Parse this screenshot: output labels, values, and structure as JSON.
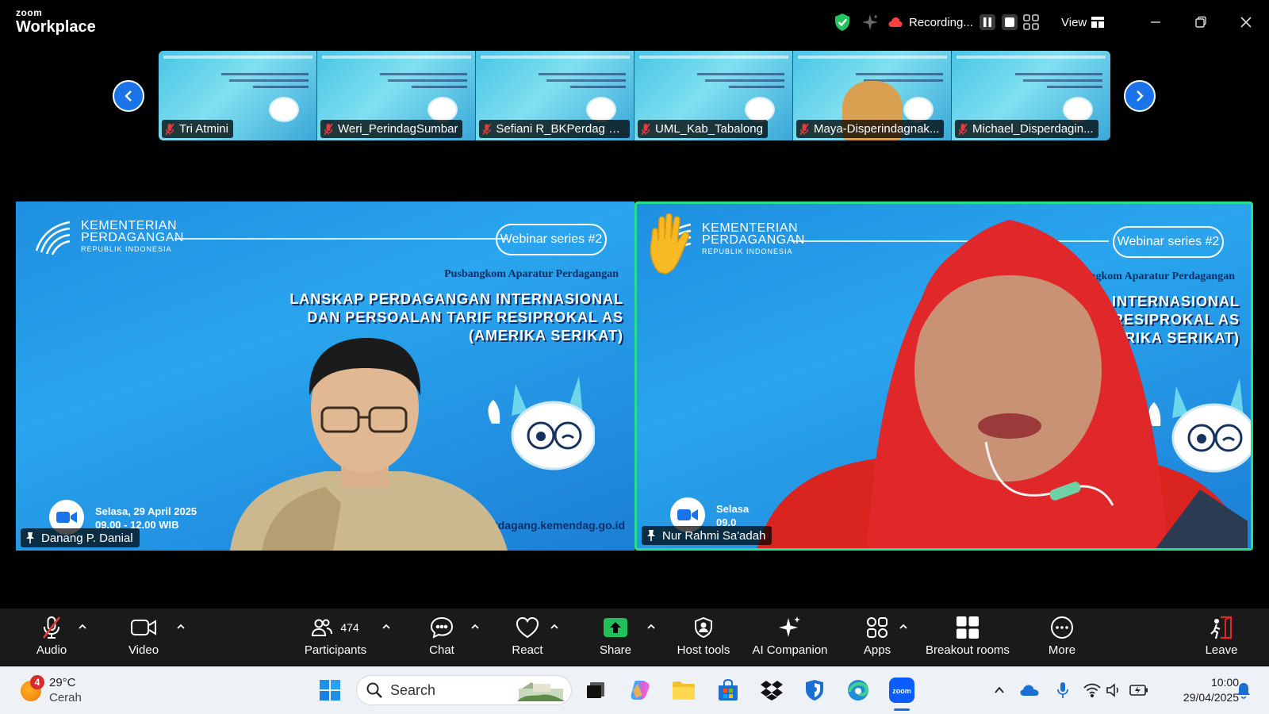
{
  "app": {
    "brand_small": "zoom",
    "brand_name": "Workplace"
  },
  "titlebar": {
    "recording_label": "Recording...",
    "view_label": "View"
  },
  "thumbnails": [
    {
      "name": "Tri Atmini"
    },
    {
      "name": "Weri_PerindagSumbar"
    },
    {
      "name": "Sefiani R_BKPerdag Ke..."
    },
    {
      "name": "UML_Kab_Tabalong"
    },
    {
      "name": "Maya-Disperindagnak..."
    },
    {
      "name": "Michael_Disperdagin..."
    }
  ],
  "slide": {
    "ministry_line1": "KEMENTERIAN",
    "ministry_line2": "PERDAGANGAN",
    "ministry_line3": "REPUBLIK INDONESIA",
    "series": "Webinar series #2",
    "organizer": "Pusbangkom Aparatur Perdagangan",
    "title_line1": "LANSKAP PERDAGANGAN INTERNASIONAL",
    "title_line2": "DAN PERSOALAN TARIF RESIPROKAL AS",
    "title_line3": "(AMERIKA SERIKAT)",
    "date": "Selasa, 29 April 2025",
    "time": "09.00 - 12.00 WIB",
    "url": "pusdiklatdagang.kemendag.go.id"
  },
  "slide_right": {
    "title_line1": "AGANGAN INTERNASIONAL",
    "title_line2": "LAN TARIF RESIPROKAL AS",
    "title_line3": "(AMERIKA SERIKAT)",
    "date": "Selasa",
    "time": "09.0"
  },
  "speakers": {
    "left": {
      "name": "Danang P. Danial"
    },
    "right": {
      "name": "Nur Rahmi Sa'adah"
    }
  },
  "toolbar": {
    "audio": "Audio",
    "video": "Video",
    "participants": "Participants",
    "participants_count": "474",
    "chat": "Chat",
    "react": "React",
    "share": "Share",
    "host_tools": "Host tools",
    "ai_companion": "AI Companion",
    "apps": "Apps",
    "breakout_rooms": "Breakout rooms",
    "more": "More",
    "leave": "Leave"
  },
  "taskbar": {
    "weather_badge": "4",
    "temperature": "29°C",
    "condition": "Cerah",
    "search_label": "Search",
    "time": "10:00",
    "date": "29/04/2025"
  },
  "colors": {
    "accent_blue": "#1a73e8",
    "active_speaker": "#25e08a",
    "share_green": "#21c05a",
    "leave_red": "#e02828"
  }
}
